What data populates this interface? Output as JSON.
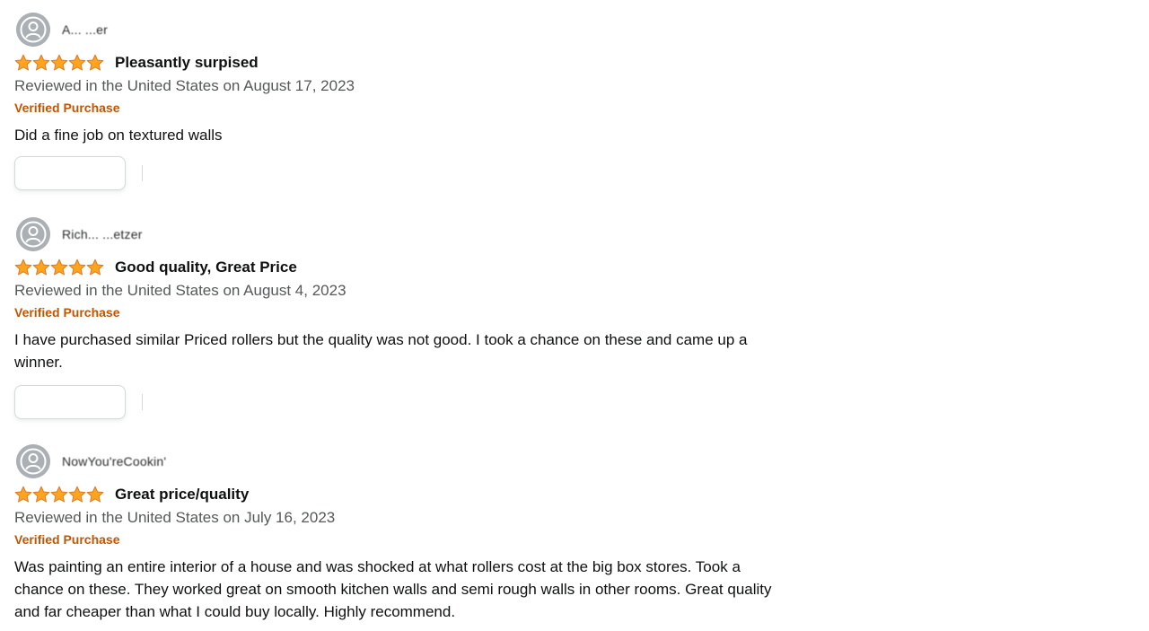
{
  "reviews": [
    {
      "profile_name": "A... ...er",
      "rating": 5,
      "title": "Pleasantly surpised",
      "date": "Reviewed in the United States on August 17, 2023",
      "verified": "Verified Purchase",
      "body": "Did a fine job on textured walls",
      "helpful_label": ""
    },
    {
      "profile_name": "Rich... ...etzer",
      "rating": 5,
      "title": "Good quality, Great Price",
      "date": "Reviewed in the United States on August 4, 2023",
      "verified": "Verified Purchase",
      "body": "I have purchased similar Priced rollers but the quality was not good. I took a chance on these and came up a winner.",
      "helpful_label": ""
    },
    {
      "profile_name": "NowYou'reCookin'",
      "rating": 5,
      "title": "Great price/quality",
      "date": "Reviewed in the United States on July 16, 2023",
      "verified": "Verified Purchase",
      "body": "Was painting an entire interior of a house and was shocked at what rollers cost at the big box stores. Took a chance on these. They worked great on smooth kitchen walls and semi rough walls in other rooms. Great quality and far cheaper than what I could buy locally. Highly recommend.",
      "helpful_label": ""
    }
  ],
  "colors": {
    "star": "#ffa41c",
    "star_stroke": "#de7921",
    "verified": "#c45500",
    "date": "#565959",
    "avatar": "#aab0b4"
  }
}
